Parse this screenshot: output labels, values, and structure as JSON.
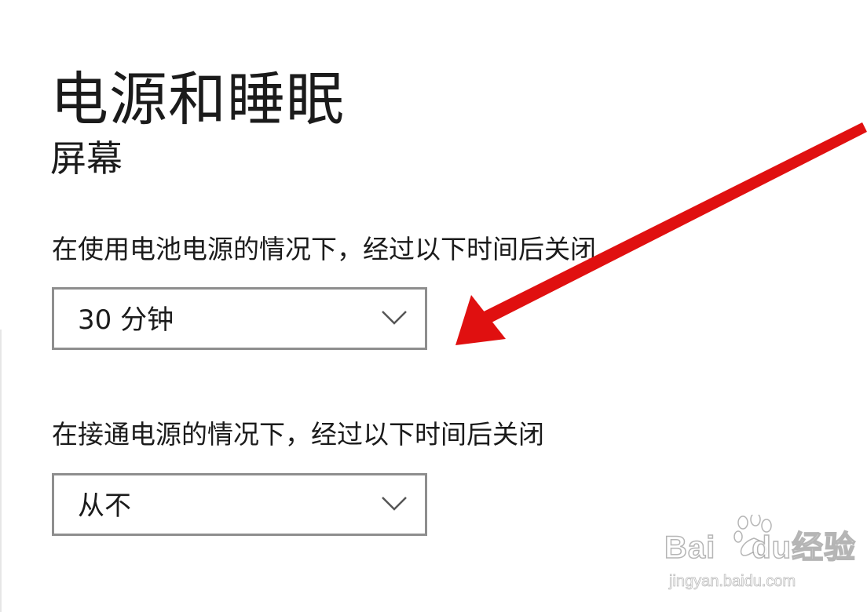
{
  "page": {
    "title": "电源和睡眠"
  },
  "screen_section": {
    "title": "屏幕",
    "battery": {
      "label": "在使用电池电源的情况下，经过以下时间后关闭",
      "selected": "30 分钟"
    },
    "plugged_in": {
      "label": "在接通电源的情况下，经过以下时间后关闭",
      "selected": "从不"
    }
  },
  "annotation": {
    "arrow_color": "#e01010"
  },
  "watermark": {
    "brand_latin": "Bai",
    "brand_latin2": "du",
    "brand_cn": "经验",
    "url": "jingyan.baidu.com"
  },
  "icons": {
    "dropdown": "chevron-down-icon",
    "watermark": "paw-icon"
  }
}
